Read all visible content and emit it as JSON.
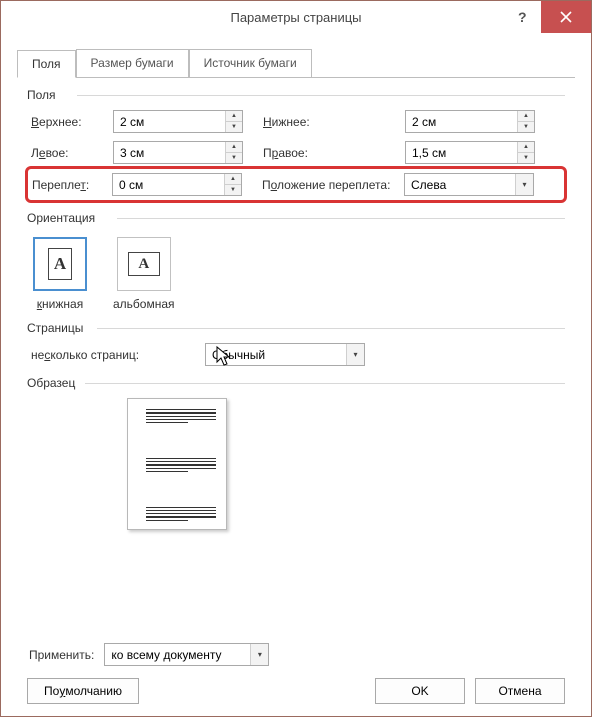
{
  "title": "Параметры страницы",
  "tabs": [
    "Поля",
    "Размер бумаги",
    "Источник бумаги"
  ],
  "margins": {
    "legend": "Поля",
    "top_label": "Верхнее:",
    "top_value": "2 см",
    "bottom_label": "Нижнее:",
    "bottom_value": "2 см",
    "left_label": "Левое:",
    "left_value": "3 см",
    "right_label": "Правое:",
    "right_value": "1,5 см",
    "gutter_label": "Переплет:",
    "gutter_value": "0 см",
    "gutter_pos_label": "Положение переплета:",
    "gutter_pos_value": "Слева"
  },
  "orientation": {
    "legend": "Ориентация",
    "portrait": "книжная",
    "landscape": "альбомная"
  },
  "pages": {
    "legend": "Страницы",
    "multiple_label": "несколько страниц:",
    "multiple_value": "Обычный"
  },
  "preview": {
    "legend": "Образец"
  },
  "apply": {
    "label": "Применить:",
    "value": "ко всему документу"
  },
  "buttons": {
    "default": "По умолчанию",
    "ok": "OK",
    "cancel": "Отмена"
  }
}
